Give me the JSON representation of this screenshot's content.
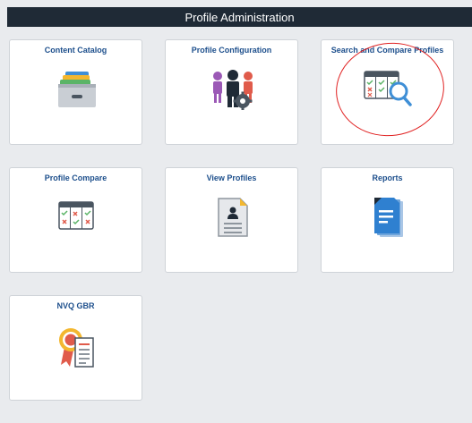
{
  "header": {
    "title": "Profile Administration"
  },
  "tiles": [
    {
      "label": "Content Catalog",
      "icon": "file-drawer-icon"
    },
    {
      "label": "Profile Configuration",
      "icon": "people-gear-icon"
    },
    {
      "label": "Search and Compare Profiles",
      "icon": "compare-table-search-icon"
    },
    {
      "label": "Profile Compare",
      "icon": "compare-table-icon"
    },
    {
      "label": "View Profiles",
      "icon": "profile-document-icon"
    },
    {
      "label": "Reports",
      "icon": "report-documents-icon"
    },
    {
      "label": "NVQ GBR",
      "icon": "award-certificate-icon"
    }
  ],
  "colors": {
    "header_bg": "#1f2a36",
    "tile_title": "#1d4f8c",
    "page_bg": "#e9ebee",
    "annotation": "#e02020"
  }
}
